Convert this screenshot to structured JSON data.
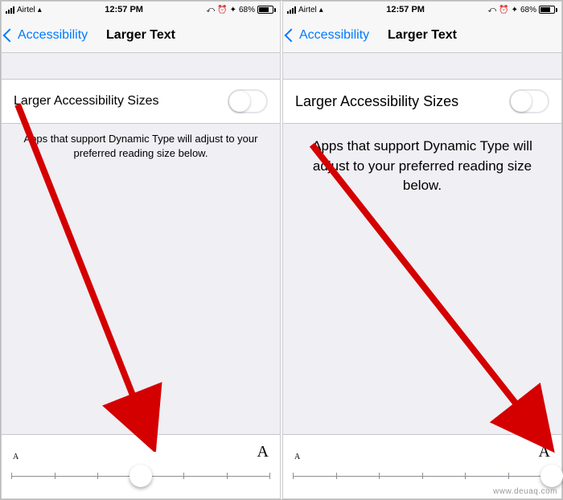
{
  "status": {
    "carrier": "Airtel",
    "time": "12:57 PM",
    "battery_pct": "68%"
  },
  "nav": {
    "back": "Accessibility",
    "title": "Larger Text"
  },
  "row": {
    "label": "Larger Accessibility Sizes",
    "toggle_on": false
  },
  "hint": "Apps that support Dynamic Type will adjust to your preferred reading size below.",
  "slider": {
    "min_label": "A",
    "max_label": "A",
    "tick_count": 7,
    "left_position_pct": 50,
    "right_position_pct": 100
  },
  "watermark": "www.deuaq.com"
}
